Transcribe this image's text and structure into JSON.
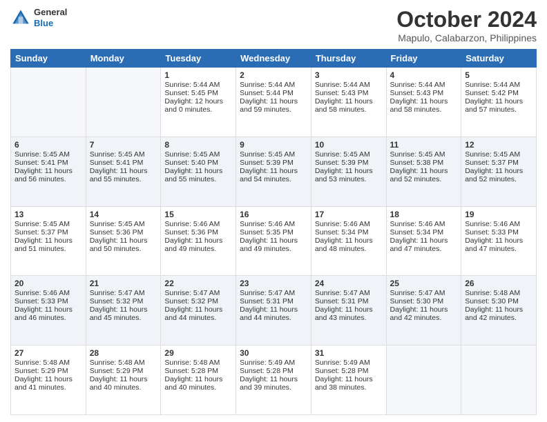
{
  "header": {
    "logo": {
      "general": "General",
      "blue": "Blue"
    },
    "title": "October 2024",
    "location": "Mapulo, Calabarzon, Philippines"
  },
  "weekdays": [
    "Sunday",
    "Monday",
    "Tuesday",
    "Wednesday",
    "Thursday",
    "Friday",
    "Saturday"
  ],
  "weeks": [
    [
      {
        "day": "",
        "sunrise": "",
        "sunset": "",
        "daylight": ""
      },
      {
        "day": "",
        "sunrise": "",
        "sunset": "",
        "daylight": ""
      },
      {
        "day": "1",
        "sunrise": "Sunrise: 5:44 AM",
        "sunset": "Sunset: 5:45 PM",
        "daylight": "Daylight: 12 hours and 0 minutes."
      },
      {
        "day": "2",
        "sunrise": "Sunrise: 5:44 AM",
        "sunset": "Sunset: 5:44 PM",
        "daylight": "Daylight: 11 hours and 59 minutes."
      },
      {
        "day": "3",
        "sunrise": "Sunrise: 5:44 AM",
        "sunset": "Sunset: 5:43 PM",
        "daylight": "Daylight: 11 hours and 58 minutes."
      },
      {
        "day": "4",
        "sunrise": "Sunrise: 5:44 AM",
        "sunset": "Sunset: 5:43 PM",
        "daylight": "Daylight: 11 hours and 58 minutes."
      },
      {
        "day": "5",
        "sunrise": "Sunrise: 5:44 AM",
        "sunset": "Sunset: 5:42 PM",
        "daylight": "Daylight: 11 hours and 57 minutes."
      }
    ],
    [
      {
        "day": "6",
        "sunrise": "Sunrise: 5:45 AM",
        "sunset": "Sunset: 5:41 PM",
        "daylight": "Daylight: 11 hours and 56 minutes."
      },
      {
        "day": "7",
        "sunrise": "Sunrise: 5:45 AM",
        "sunset": "Sunset: 5:41 PM",
        "daylight": "Daylight: 11 hours and 55 minutes."
      },
      {
        "day": "8",
        "sunrise": "Sunrise: 5:45 AM",
        "sunset": "Sunset: 5:40 PM",
        "daylight": "Daylight: 11 hours and 55 minutes."
      },
      {
        "day": "9",
        "sunrise": "Sunrise: 5:45 AM",
        "sunset": "Sunset: 5:39 PM",
        "daylight": "Daylight: 11 hours and 54 minutes."
      },
      {
        "day": "10",
        "sunrise": "Sunrise: 5:45 AM",
        "sunset": "Sunset: 5:39 PM",
        "daylight": "Daylight: 11 hours and 53 minutes."
      },
      {
        "day": "11",
        "sunrise": "Sunrise: 5:45 AM",
        "sunset": "Sunset: 5:38 PM",
        "daylight": "Daylight: 11 hours and 52 minutes."
      },
      {
        "day": "12",
        "sunrise": "Sunrise: 5:45 AM",
        "sunset": "Sunset: 5:37 PM",
        "daylight": "Daylight: 11 hours and 52 minutes."
      }
    ],
    [
      {
        "day": "13",
        "sunrise": "Sunrise: 5:45 AM",
        "sunset": "Sunset: 5:37 PM",
        "daylight": "Daylight: 11 hours and 51 minutes."
      },
      {
        "day": "14",
        "sunrise": "Sunrise: 5:45 AM",
        "sunset": "Sunset: 5:36 PM",
        "daylight": "Daylight: 11 hours and 50 minutes."
      },
      {
        "day": "15",
        "sunrise": "Sunrise: 5:46 AM",
        "sunset": "Sunset: 5:36 PM",
        "daylight": "Daylight: 11 hours and 49 minutes."
      },
      {
        "day": "16",
        "sunrise": "Sunrise: 5:46 AM",
        "sunset": "Sunset: 5:35 PM",
        "daylight": "Daylight: 11 hours and 49 minutes."
      },
      {
        "day": "17",
        "sunrise": "Sunrise: 5:46 AM",
        "sunset": "Sunset: 5:34 PM",
        "daylight": "Daylight: 11 hours and 48 minutes."
      },
      {
        "day": "18",
        "sunrise": "Sunrise: 5:46 AM",
        "sunset": "Sunset: 5:34 PM",
        "daylight": "Daylight: 11 hours and 47 minutes."
      },
      {
        "day": "19",
        "sunrise": "Sunrise: 5:46 AM",
        "sunset": "Sunset: 5:33 PM",
        "daylight": "Daylight: 11 hours and 47 minutes."
      }
    ],
    [
      {
        "day": "20",
        "sunrise": "Sunrise: 5:46 AM",
        "sunset": "Sunset: 5:33 PM",
        "daylight": "Daylight: 11 hours and 46 minutes."
      },
      {
        "day": "21",
        "sunrise": "Sunrise: 5:47 AM",
        "sunset": "Sunset: 5:32 PM",
        "daylight": "Daylight: 11 hours and 45 minutes."
      },
      {
        "day": "22",
        "sunrise": "Sunrise: 5:47 AM",
        "sunset": "Sunset: 5:32 PM",
        "daylight": "Daylight: 11 hours and 44 minutes."
      },
      {
        "day": "23",
        "sunrise": "Sunrise: 5:47 AM",
        "sunset": "Sunset: 5:31 PM",
        "daylight": "Daylight: 11 hours and 44 minutes."
      },
      {
        "day": "24",
        "sunrise": "Sunrise: 5:47 AM",
        "sunset": "Sunset: 5:31 PM",
        "daylight": "Daylight: 11 hours and 43 minutes."
      },
      {
        "day": "25",
        "sunrise": "Sunrise: 5:47 AM",
        "sunset": "Sunset: 5:30 PM",
        "daylight": "Daylight: 11 hours and 42 minutes."
      },
      {
        "day": "26",
        "sunrise": "Sunrise: 5:48 AM",
        "sunset": "Sunset: 5:30 PM",
        "daylight": "Daylight: 11 hours and 42 minutes."
      }
    ],
    [
      {
        "day": "27",
        "sunrise": "Sunrise: 5:48 AM",
        "sunset": "Sunset: 5:29 PM",
        "daylight": "Daylight: 11 hours and 41 minutes."
      },
      {
        "day": "28",
        "sunrise": "Sunrise: 5:48 AM",
        "sunset": "Sunset: 5:29 PM",
        "daylight": "Daylight: 11 hours and 40 minutes."
      },
      {
        "day": "29",
        "sunrise": "Sunrise: 5:48 AM",
        "sunset": "Sunset: 5:28 PM",
        "daylight": "Daylight: 11 hours and 40 minutes."
      },
      {
        "day": "30",
        "sunrise": "Sunrise: 5:49 AM",
        "sunset": "Sunset: 5:28 PM",
        "daylight": "Daylight: 11 hours and 39 minutes."
      },
      {
        "day": "31",
        "sunrise": "Sunrise: 5:49 AM",
        "sunset": "Sunset: 5:28 PM",
        "daylight": "Daylight: 11 hours and 38 minutes."
      },
      {
        "day": "",
        "sunrise": "",
        "sunset": "",
        "daylight": ""
      },
      {
        "day": "",
        "sunrise": "",
        "sunset": "",
        "daylight": ""
      }
    ]
  ]
}
